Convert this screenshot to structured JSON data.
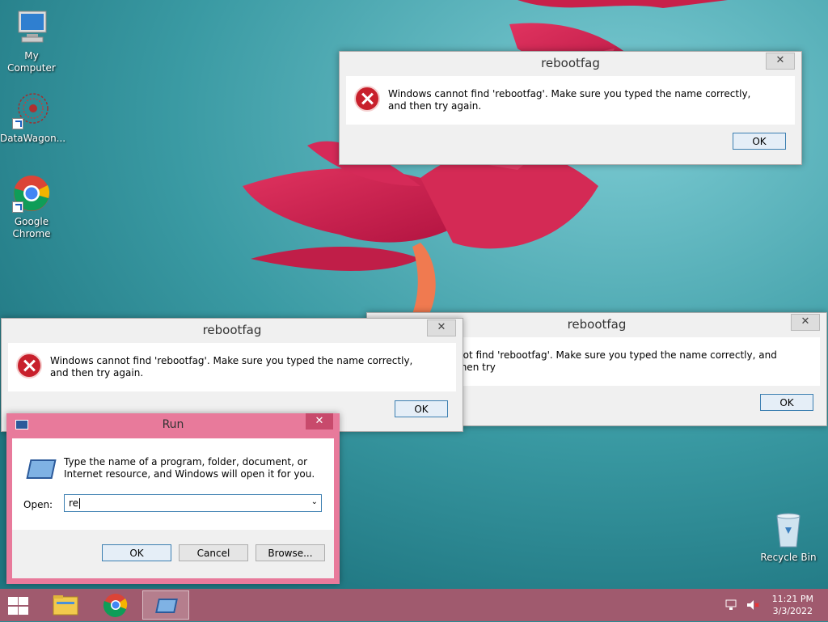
{
  "desktop": {
    "icons": [
      {
        "label": "My Computer"
      },
      {
        "label": "DataWagon..."
      },
      {
        "label": "Google Chrome"
      },
      {
        "label": "Recycle Bin"
      }
    ]
  },
  "error_dialogs": [
    {
      "title": "rebootfag",
      "message": "Windows cannot find 'rebootfag'. Make sure you typed the name correctly, and then try again.",
      "ok_label": "OK"
    },
    {
      "title": "rebootfag",
      "message": "Windows cannot find 'rebootfag'. Make sure you typed the name correctly, and then try again.",
      "ok_label": "OK"
    },
    {
      "title": "rebootfag",
      "message": "not find 'rebootfag'. Make sure you typed the name correctly, and then try",
      "ok_label": "OK"
    }
  ],
  "run_dialog": {
    "title": "Run",
    "description": "Type the name of a program, folder, document, or Internet resource, and Windows will open it for you.",
    "open_label": "Open:",
    "open_value": "re",
    "ok_label": "OK",
    "cancel_label": "Cancel",
    "browse_label": "Browse..."
  },
  "taskbar": {
    "time": "11:21 PM",
    "date": "3/3/2022"
  },
  "colors": {
    "desktop_bg": "#2a8a93",
    "run_frame": "#e87a9b",
    "taskbar": "#a05a6e"
  }
}
